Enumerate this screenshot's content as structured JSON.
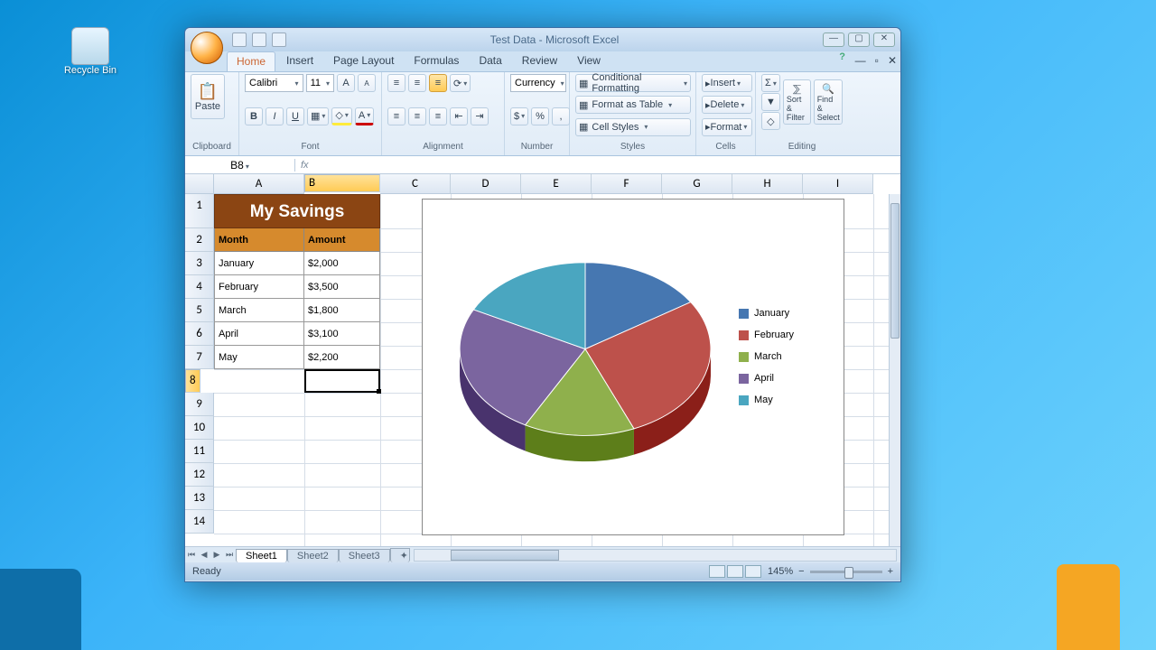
{
  "desktop": {
    "recycle_bin": "Recycle Bin"
  },
  "window": {
    "title": "Test Data - Microsoft Excel",
    "tabs": [
      "Home",
      "Insert",
      "Page Layout",
      "Formulas",
      "Data",
      "Review",
      "View"
    ],
    "active_tab": "Home"
  },
  "ribbon": {
    "clipboard": {
      "paste": "Paste",
      "title": "Clipboard"
    },
    "font": {
      "name": "Calibri",
      "size": "11",
      "title": "Font"
    },
    "alignment": {
      "title": "Alignment"
    },
    "number": {
      "format": "Currency",
      "title": "Number"
    },
    "styles": {
      "cond": "Conditional Formatting",
      "table": "Format as Table",
      "cell": "Cell Styles",
      "title": "Styles"
    },
    "cells": {
      "insert": "Insert",
      "delete": "Delete",
      "format": "Format",
      "title": "Cells"
    },
    "editing": {
      "sort": "Sort & Filter",
      "find": "Find & Select",
      "title": "Editing"
    }
  },
  "namebox": {
    "ref": "B8",
    "fx": "fx"
  },
  "columns": [
    "A",
    "B",
    "C",
    "D",
    "E",
    "F",
    "G",
    "H",
    "I"
  ],
  "rows": [
    "1",
    "2",
    "3",
    "4",
    "5",
    "6",
    "7",
    "8",
    "9",
    "10",
    "11",
    "12",
    "13",
    "14"
  ],
  "table": {
    "title": "My Savings",
    "headers": {
      "month": "Month",
      "amount": "Amount"
    },
    "rows": [
      {
        "month": "January",
        "amount": "$2,000"
      },
      {
        "month": "February",
        "amount": "$3,500"
      },
      {
        "month": "March",
        "amount": "$1,800"
      },
      {
        "month": "April",
        "amount": "$3,100"
      },
      {
        "month": "May",
        "amount": "$2,200"
      }
    ]
  },
  "chart_data": {
    "type": "pie",
    "title": "",
    "categories": [
      "January",
      "February",
      "March",
      "April",
      "May"
    ],
    "values": [
      2000,
      3500,
      1800,
      3100,
      2200
    ],
    "colors": [
      "#4677b1",
      "#bd514b",
      "#8fb04c",
      "#7b659f",
      "#4aa6c0"
    ],
    "legend_position": "right"
  },
  "sheets": {
    "active": "Sheet1",
    "list": [
      "Sheet1",
      "Sheet2",
      "Sheet3"
    ]
  },
  "status": {
    "ready": "Ready",
    "zoom": "145%"
  }
}
